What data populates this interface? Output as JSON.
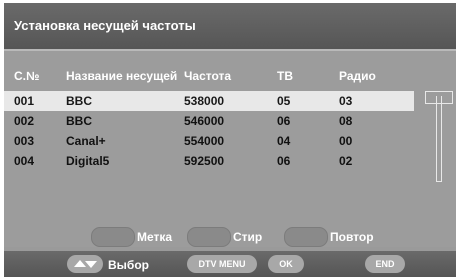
{
  "title": "Установка несущей частоты",
  "table": {
    "headers": [
      "C.№",
      "Название несущей",
      "Частота",
      "ТВ",
      "Радио"
    ],
    "rows": [
      [
        "001",
        "BBC",
        "538000",
        "05",
        "03"
      ],
      [
        "002",
        "BBC",
        "546000",
        "06",
        "08"
      ],
      [
        "003",
        "Canal+",
        "554000",
        "04",
        "00"
      ],
      [
        "004",
        "Digital5",
        "592500",
        "06",
        "02"
      ]
    ],
    "selected_index": 0
  },
  "colour_keys": [
    "Метка",
    "Стир",
    "Повтор"
  ],
  "bottom": {
    "nav_label": "Выбор",
    "dtv_menu": "DTV MENU",
    "ok": "OK",
    "end": "END"
  },
  "colors": {
    "background": "#9c9c9c",
    "title_bar": "#5e5e5e",
    "selected_row": "#e8e8e8",
    "text_light": "#ffffff",
    "text_dark": "#111111"
  },
  "icons": [
    "up-down-arrow-icon"
  ]
}
